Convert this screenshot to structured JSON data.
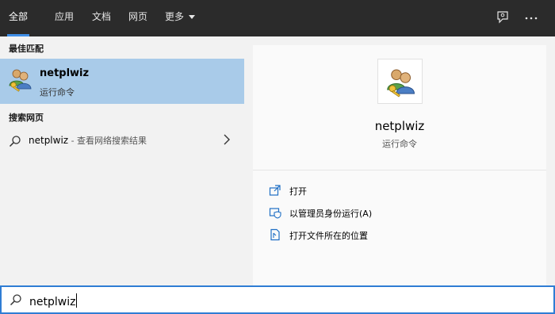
{
  "tabs": [
    {
      "label": "全部",
      "active": true
    },
    {
      "label": "应用"
    },
    {
      "label": "文档"
    },
    {
      "label": "网页"
    },
    {
      "label": "更多"
    }
  ],
  "top_icons": [
    "feedback-icon",
    "more-options-icon"
  ],
  "left": {
    "best_match_heading": "最佳匹配",
    "best_match": {
      "title": "netplwiz",
      "subtitle": "运行命令",
      "icon": "user-accounts-icon"
    },
    "web_heading": "搜索网页",
    "web_result": {
      "query": "netplwiz",
      "description": " - 查看网络搜索结果",
      "icon": "search-icon"
    }
  },
  "preview": {
    "title": "netplwiz",
    "subtitle": "运行命令",
    "actions": [
      {
        "label": "打开",
        "icon": "open-icon"
      },
      {
        "label": "以管理员身份运行(A)",
        "icon": "shield-icon"
      },
      {
        "label": "打开文件所在的位置",
        "icon": "file-location-icon"
      }
    ]
  },
  "search": {
    "value": "netplwiz"
  },
  "colors": {
    "topbar": "#2b2b2b",
    "accent": "#3f8ee6",
    "selected": "#a9cbe9",
    "search_border": "#2f7dd4"
  }
}
